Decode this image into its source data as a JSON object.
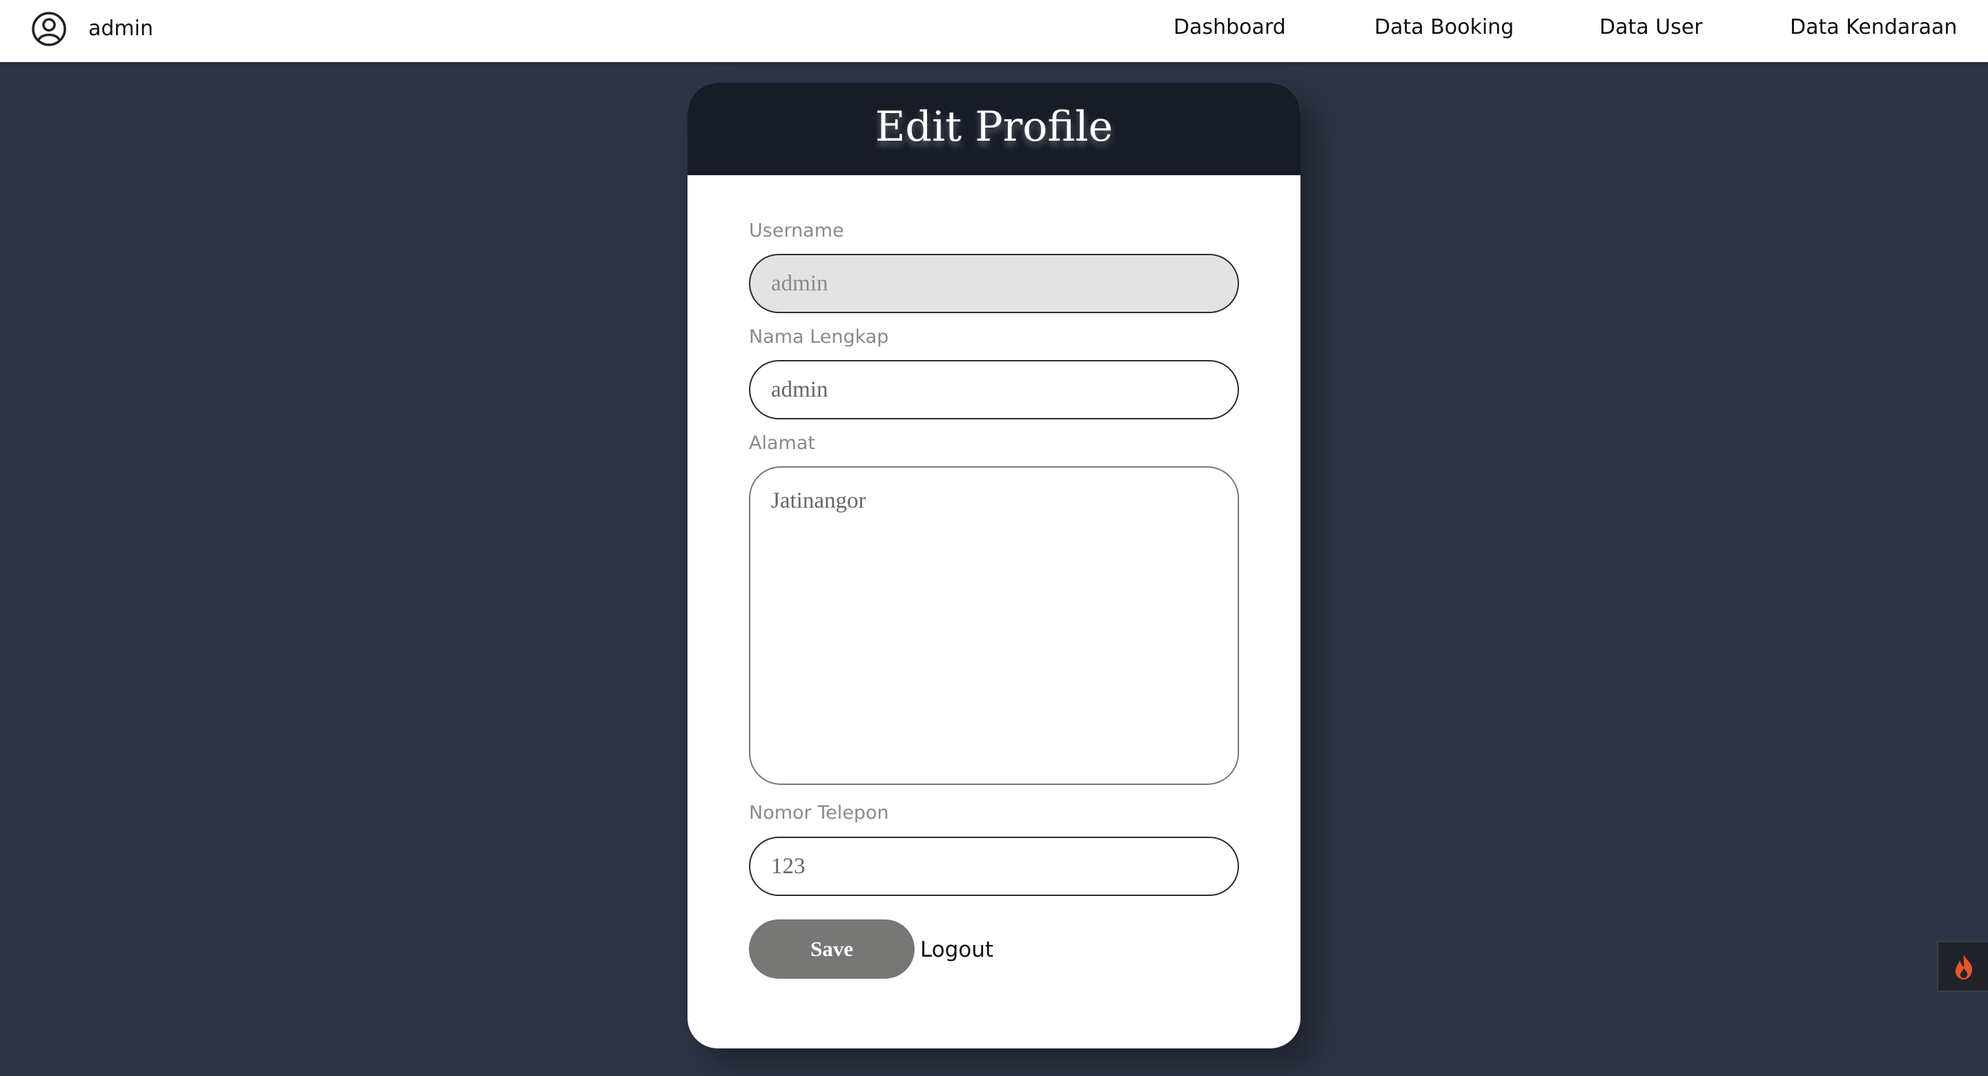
{
  "navbar": {
    "user_icon": "user-circle-icon",
    "username": "admin",
    "links": {
      "dashboard": "Dashboard",
      "booking": "Data Booking",
      "user": "Data User",
      "kendaraan": "Data Kendaraan"
    }
  },
  "card": {
    "title": "Edit Profile",
    "fields": {
      "username": {
        "label": "Username",
        "value": "admin"
      },
      "nama": {
        "label": "Nama Lengkap",
        "value": "admin"
      },
      "alamat": {
        "label": "Alamat",
        "value": "Jatinangor"
      },
      "telepon": {
        "label": "Nomor Telepon",
        "value": "123"
      }
    },
    "save_label": "Save",
    "logout_label": "Logout"
  },
  "floating_toolbar": {
    "icon": "flame-icon"
  },
  "colors": {
    "background": "#2e3445",
    "header": "#171c26",
    "save_button": "#777775",
    "readonly_field": "#e3e3e3",
    "flame": "#e8542a"
  }
}
